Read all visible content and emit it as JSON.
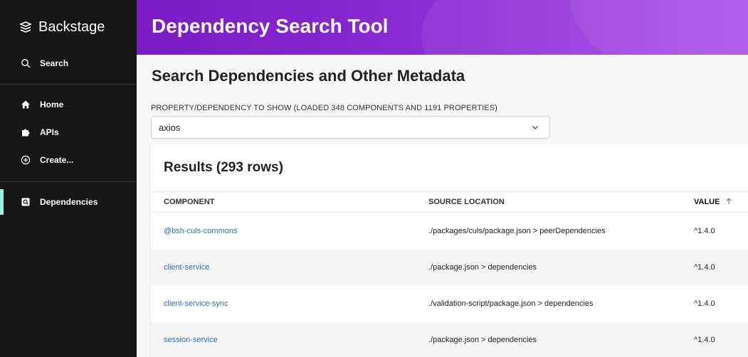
{
  "sidebar": {
    "brand": "Backstage",
    "search_label": "Search",
    "items": [
      {
        "label": "Home",
        "icon": "home-icon"
      },
      {
        "label": "APIs",
        "icon": "puzzle-icon"
      },
      {
        "label": "Create...",
        "icon": "add-circle-icon"
      },
      {
        "label": "Dependencies",
        "icon": "dependency-search-icon"
      }
    ],
    "active_color": "#9bf0e1"
  },
  "header": {
    "title": "Dependency Search Tool",
    "gradient": [
      "#7a1bc4",
      "#a64be8"
    ]
  },
  "main": {
    "subtitle": "Search Dependencies and Other Metadata",
    "field_label": "PROPERTY/DEPENDENCY TO SHOW (LOADED 348 COMPONENTS AND 1191 PROPERTIES)",
    "select_value": "axios"
  },
  "results": {
    "title": "Results (293 rows)",
    "columns": [
      "COMPONENT",
      "SOURCE LOCATION",
      "VALUE"
    ],
    "sort_indicator": "arrow-up-icon",
    "rows": [
      {
        "component": "@bsh-culs-commons",
        "source": "./packages/culs/package.json > peerDependencies",
        "value": "^1.4.0"
      },
      {
        "component": "client-service",
        "source": "./package.json > dependencies",
        "value": "^1.4.0"
      },
      {
        "component": "client-service-sync",
        "source": "./validation-script/package.json > dependencies",
        "value": "^1.4.0"
      },
      {
        "component": "session-service",
        "source": "./package.json > dependencies",
        "value": "^1.4.0"
      }
    ],
    "link_color": "#2b6cc4"
  }
}
